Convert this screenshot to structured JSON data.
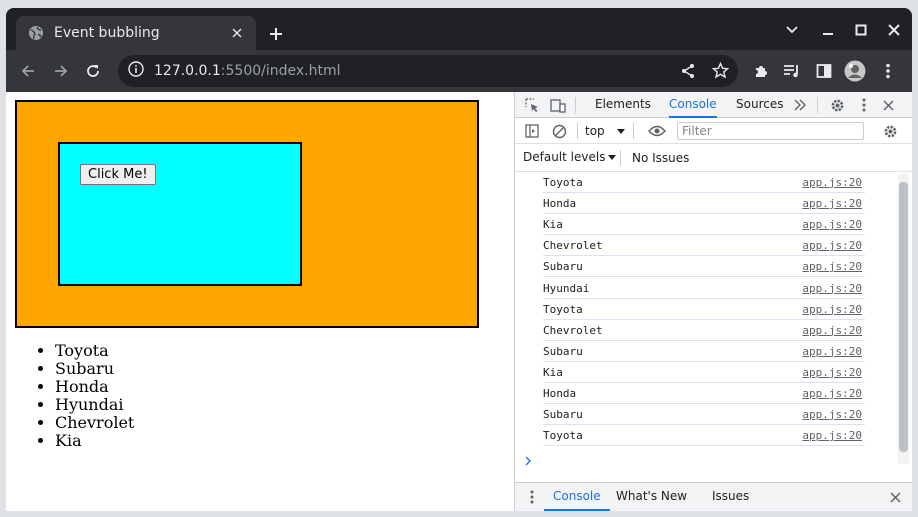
{
  "browser": {
    "tab_title": "Event bubbling",
    "url_host": "127.0.0.1",
    "url_rest": ":5500/index.html"
  },
  "page": {
    "button_label": "Click Me!",
    "list_items": [
      "Toyota",
      "Subaru",
      "Honda",
      "Hyundai",
      "Chevrolet",
      "Kia"
    ],
    "outer_color": "#ffa500",
    "inner_color": "#00ffff"
  },
  "devtools": {
    "tabs": [
      "Elements",
      "Console",
      "Sources"
    ],
    "active_tab": "Console",
    "context": "top",
    "filter_placeholder": "Filter",
    "levels_label": "Default levels",
    "issues_label": "No Issues",
    "console_logs": [
      {
        "msg": "Toyota",
        "src": "app.js:20"
      },
      {
        "msg": "Honda",
        "src": "app.js:20"
      },
      {
        "msg": "Kia",
        "src": "app.js:20"
      },
      {
        "msg": "Chevrolet",
        "src": "app.js:20"
      },
      {
        "msg": "Subaru",
        "src": "app.js:20"
      },
      {
        "msg": "Hyundai",
        "src": "app.js:20"
      },
      {
        "msg": "Toyota",
        "src": "app.js:20"
      },
      {
        "msg": "Chevrolet",
        "src": "app.js:20"
      },
      {
        "msg": "Subaru",
        "src": "app.js:20"
      },
      {
        "msg": "Kia",
        "src": "app.js:20"
      },
      {
        "msg": "Honda",
        "src": "app.js:20"
      },
      {
        "msg": "Subaru",
        "src": "app.js:20"
      },
      {
        "msg": "Toyota",
        "src": "app.js:20"
      }
    ],
    "drawer_tabs": [
      "Console",
      "What's New",
      "Issues"
    ]
  }
}
